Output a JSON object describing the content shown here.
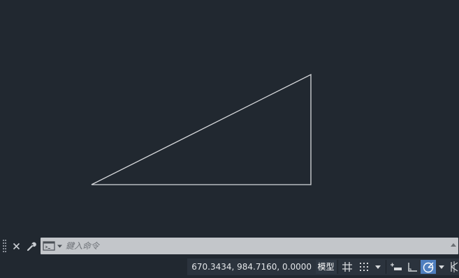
{
  "command_line": {
    "placeholder": "鍵入命令"
  },
  "status_bar": {
    "coordinates": "670.3434, 984.7160, 0.0000",
    "model_label": "模型"
  },
  "icons": {
    "grip": "grip-handle-icon",
    "close": "close-icon",
    "customize": "wrench-icon",
    "history": "command-prompt-icon",
    "grid": "grid-icon",
    "snap": "snap-dots-icon",
    "infer": "infer-constraints-icon",
    "ortho": "ortho-icon",
    "polar": "polar-tracking-icon",
    "isodraft": "isodraft-icon"
  },
  "colors": {
    "canvas_background": "#212830",
    "geometry_stroke": "#d7d9dc",
    "active_toggle": "#4f7fbf",
    "command_input_bg": "#c3c6ca"
  }
}
